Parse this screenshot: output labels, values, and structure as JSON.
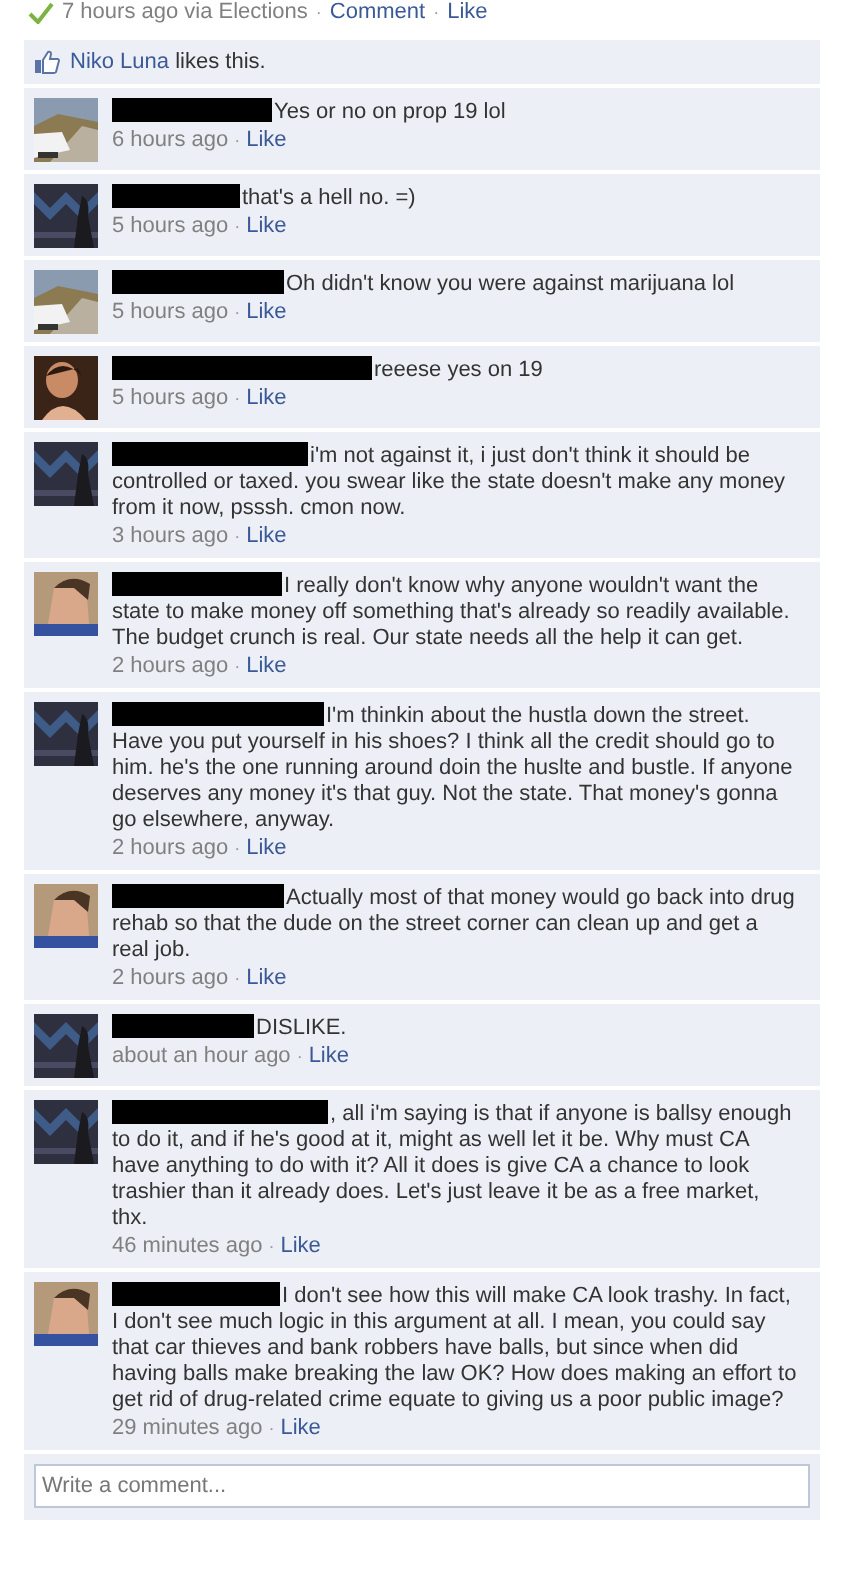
{
  "separator": "·",
  "post_meta": {
    "time": "7 hours ago via Elections",
    "comment_link": "Comment",
    "like_link": "Like"
  },
  "likes": {
    "name": "Niko Luna",
    "text": "likes this."
  },
  "comments": [
    {
      "text": "Yes or no on prop 19 lol",
      "time": "6 hours ago",
      "like": "Like"
    },
    {
      "text": "that's a hell no. =)",
      "time": "5 hours ago",
      "like": "Like"
    },
    {
      "text": "Oh didn't know you were against marijuana lol",
      "time": "5 hours ago",
      "like": "Like"
    },
    {
      "text": "reeese yes on 19",
      "time": "5 hours ago",
      "like": "Like"
    },
    {
      "text": "i'm not against it, i just don't think it should be controlled or taxed. you swear like the state doesn't make any money from it now, psssh. cmon now.",
      "time": "3 hours ago",
      "like": "Like"
    },
    {
      "text": "I really don't know why anyone wouldn't want the state to make money off something that's already so readily available. The budget crunch is real. Our state needs all the help it can get.",
      "time": "2 hours ago",
      "like": "Like"
    },
    {
      "text": "I'm thinkin about the hustla down the street. Have you put yourself in his shoes? I think all the credit should go to him. he's the one running around doin the huslte and bustle. If anyone deserves any money it's that guy. Not the state. That money's gonna go elsewhere, anyway.",
      "time": "2 hours ago",
      "like": "Like"
    },
    {
      "text": "Actually most of that money would go back into drug rehab so that the dude on the street corner can clean up and get a real job.",
      "time": "2 hours ago",
      "like": "Like"
    },
    {
      "text": "DISLIKE.",
      "time": "about an hour ago",
      "like": "Like"
    },
    {
      "text": ", all i'm saying is that if anyone is ballsy enough to do it, and if he's good at it, might as well let it be. Why must CA have anything to do with it? All it does is give CA a chance to look trashier than it already does. Let's just leave it be as a free market, thx.",
      "time": "46 minutes ago",
      "like": "Like"
    },
    {
      "text": "I don't see how this will make CA look trashy. In fact, I don't see much logic in this argument at all. I mean, you could say that car thieves and bank robbers have balls, but since when did having balls make breaking the law OK? How does making an effort to get rid of drug-related crime equate to giving us a poor public image?",
      "time": "29 minutes ago",
      "like": "Like"
    }
  ],
  "comment_box": {
    "placeholder": "Write a comment..."
  }
}
